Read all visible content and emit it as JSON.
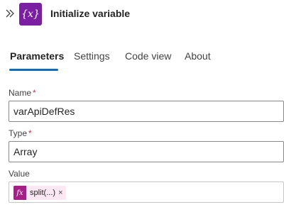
{
  "colors": {
    "accent": "#0f6cbd",
    "action_purple": "#7b1fa2",
    "token_purple": "#a61e88",
    "token_bg": "#fbe8f4"
  },
  "header": {
    "collapse_icon": "double-chevron-right-icon",
    "action_icon_glyph": "{x}",
    "title": "Initialize variable"
  },
  "tabs": [
    {
      "label": "Parameters",
      "active": true
    },
    {
      "label": "Settings",
      "active": false
    },
    {
      "label": "Code view",
      "active": false
    },
    {
      "label": "About",
      "active": false
    }
  ],
  "fields": {
    "name": {
      "label": "Name",
      "required_mark": "*",
      "value": "varApiDefRes"
    },
    "type": {
      "label": "Type",
      "required_mark": "*",
      "value": "Array"
    },
    "value": {
      "label": "Value",
      "token": {
        "icon_glyph": "fx",
        "text": "split(...)",
        "remove_glyph": "×"
      }
    }
  }
}
